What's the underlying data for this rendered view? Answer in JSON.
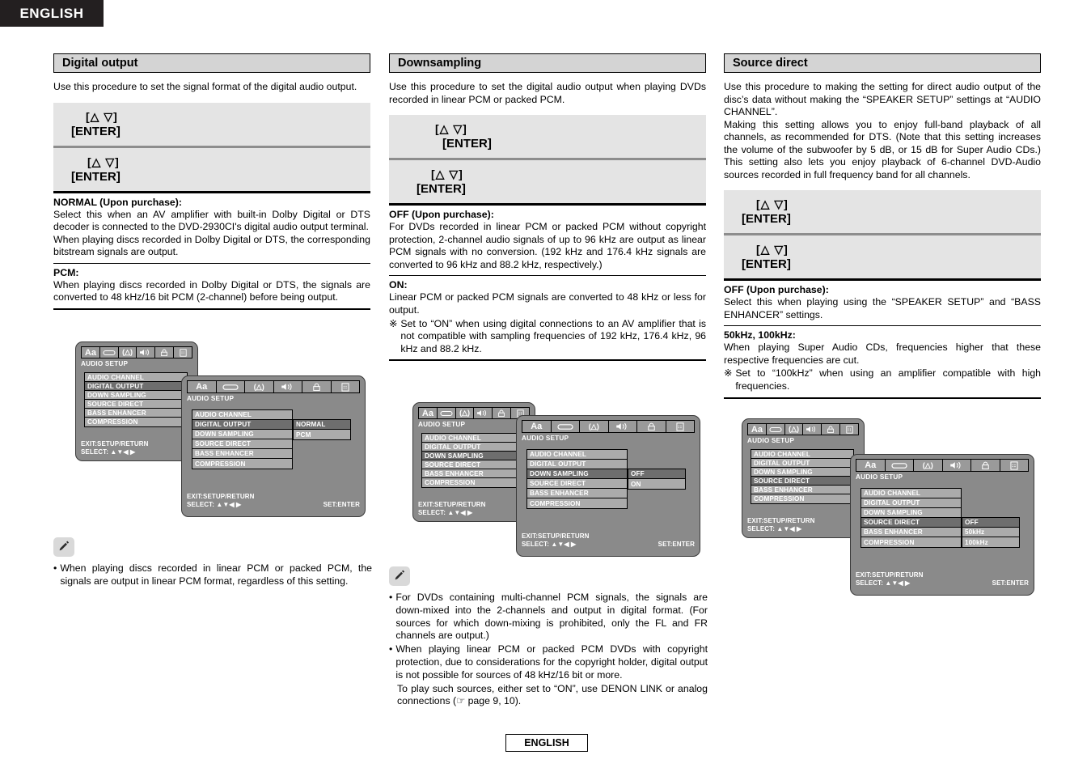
{
  "page": {
    "language_tab": "ENGLISH",
    "footer_label": "ENGLISH"
  },
  "osd_common": {
    "title": "AUDIO SETUP",
    "icons": [
      "Aa",
      "disc-icon",
      "(A)",
      "speaker-icon",
      "lock-icon",
      "remote-icon"
    ],
    "menu_items": [
      "AUDIO CHANNEL",
      "DIGITAL OUTPUT",
      "DOWN SAMPLING",
      "SOURCE DIRECT",
      "BASS ENHANCER",
      "COMPRESSION"
    ],
    "footer_exit": "EXIT:SETUP/RETURN",
    "footer_select": "SELECT: ▲▼◀ ▶",
    "footer_set": "SET:ENTER"
  },
  "columns": [
    {
      "id": "digital-output",
      "header": "Digital output",
      "intro": "Use this procedure to set the signal format of the digital audio output.",
      "keys": [
        {
          "arrows": "[△ ▽]",
          "enter": "[ENTER]"
        },
        {
          "arrows": "[△  ▽]",
          "enter": "[ENTER]"
        }
      ],
      "options": [
        {
          "title": "NORMAL (Upon purchase):",
          "body": "Select this when an AV amplifier with built-in Dolby Digital or DTS decoder is connected to the DVD-2930CI's digital audio output terminal.\nWhen playing discs recorded in Dolby Digital or DTS, the corresponding bitstream signals are output."
        },
        {
          "title": "PCM:",
          "body": "When playing discs recorded in Dolby Digital or DTS, the signals are converted to 48 kHz/16 bit PCM (2-channel) before being output."
        }
      ],
      "note": {
        "icon": "pencil-icon",
        "items": [
          "When playing discs recorded in linear PCM or packed PCM, the signals are output in linear PCM format, regardless of this setting."
        ]
      },
      "osd_back": {
        "highlight": "DIGITAL OUTPUT"
      },
      "osd_front": {
        "highlight": "DIGITAL OUTPUT",
        "values": [
          "NORMAL",
          "PCM"
        ],
        "selected_value": "NORMAL"
      }
    },
    {
      "id": "downsampling",
      "header": "Downsampling",
      "intro": "Use this procedure to set the digital audio output when playing DVDs recorded in linear PCM or packed PCM.",
      "keys": [
        {
          "arrows": "[△  ▽]",
          "enter": "[ENTER]"
        },
        {
          "arrows": "[△  ▽]",
          "enter": "[ENTER]"
        }
      ],
      "options": [
        {
          "title": "OFF (Upon purchase):",
          "body": "For DVDs recorded in linear PCM or packed PCM without copyright protection, 2-channel audio signals of up to 96 kHz are output as linear PCM signals with no conversion. (192 kHz and 176.4 kHz signals are converted to 96 kHz and 88.2 kHz, respectively.)"
        },
        {
          "title": "ON:",
          "body": "Linear PCM or packed PCM signals are converted to 48 kHz or less for output.",
          "star": "※",
          "star_text": "Set to “ON” when using digital connections to an AV amplifier that is not compatible with sampling frequencies of 192 kHz, 176.4 kHz, 96 kHz and 88.2 kHz."
        }
      ],
      "note": {
        "icon": "pencil-icon",
        "items": [
          "For DVDs containing multi-channel PCM signals, the signals are down-mixed into the 2-channels and output in digital format. (For sources for which down-mixing is prohibited, only the FL and FR channels are output.)",
          "When playing linear PCM or packed PCM DVDs with copyright protection, due to considerations for the copyright holder, digital output is not possible for sources of 48 kHz/16 bit or more."
        ],
        "sub": "To play such sources, either set to “ON”, use DENON LINK or analog connections (☞ page 9, 10)."
      },
      "osd_back": {
        "highlight": "DOWN SAMPLING"
      },
      "osd_front": {
        "highlight": "DOWN SAMPLING",
        "values": [
          "OFF",
          "ON"
        ],
        "selected_value": "OFF"
      }
    },
    {
      "id": "source-direct",
      "header": "Source direct",
      "intro": "Use this procedure to making the setting for direct audio output of the disc’s data without making the “SPEAKER SETUP” settings at “AUDIO CHANNEL”.\nMaking this setting allows you to enjoy full-band playback of all channels, as recommended for DTS. (Note that this setting increases the volume of the subwoofer by 5 dB, or 15 dB for Super Audio CDs.) This setting also lets you enjoy playback of 6-channel DVD-Audio sources recorded in full frequency band for all channels.",
      "keys": [
        {
          "arrows": "[△ ▽]",
          "enter": "[ENTER]"
        },
        {
          "arrows": "[△ ▽]",
          "enter": "[ENTER]"
        }
      ],
      "options": [
        {
          "title": "OFF (Upon purchase):",
          "body": "Select this when playing using the “SPEAKER SETUP” and “BASS ENHANCER” settings."
        },
        {
          "title": "50kHz, 100kHz:",
          "body": "When playing Super Audio CDs, frequencies higher that these respective frequencies are cut.",
          "star": "※",
          "star_text": "Set to “100kHz” when using an amplifier compatible with high frequencies."
        }
      ],
      "osd_back": {
        "highlight": "SOURCE DIRECT"
      },
      "osd_front": {
        "highlight": "SOURCE DIRECT",
        "values": [
          "OFF",
          "50kHz",
          "100kHz"
        ],
        "selected_value": "OFF"
      }
    }
  ]
}
